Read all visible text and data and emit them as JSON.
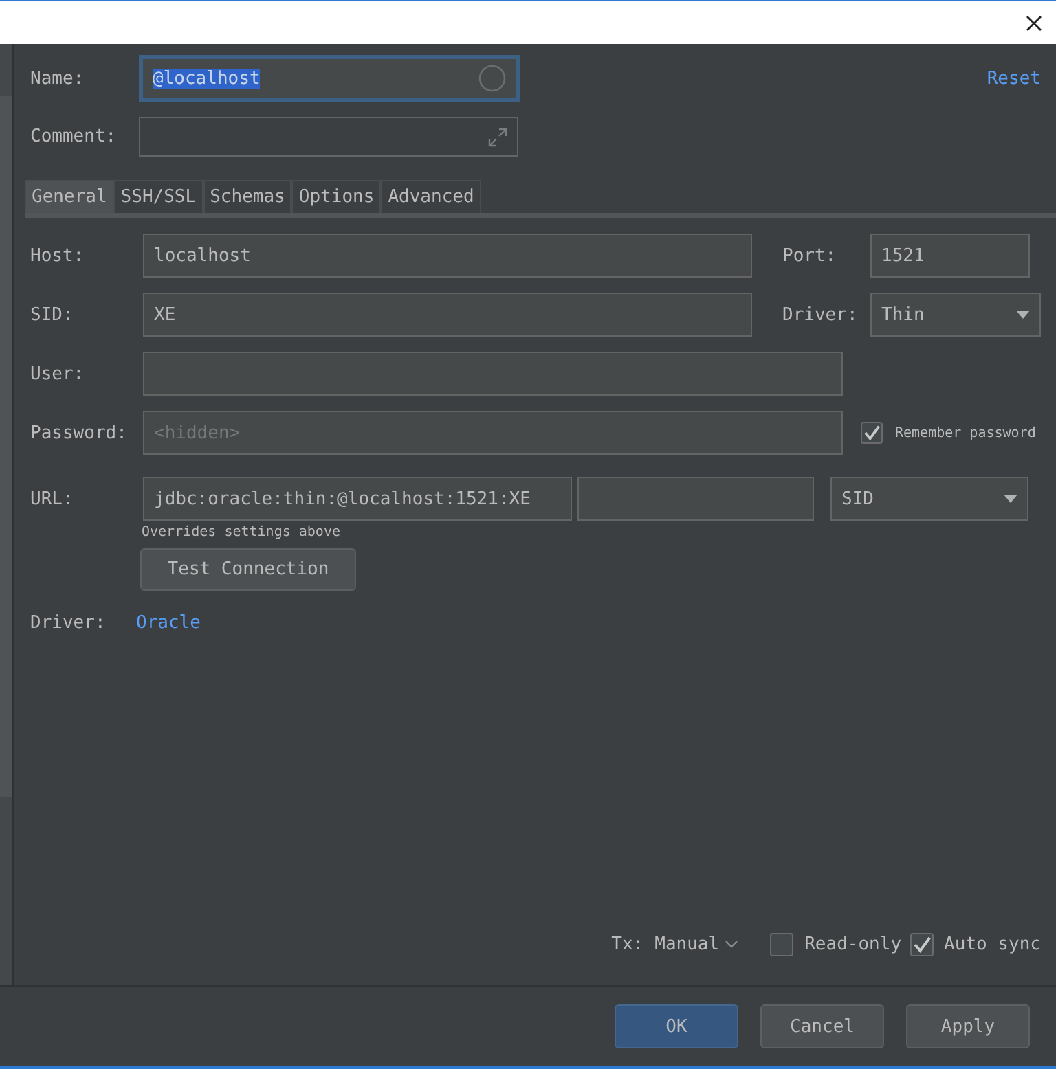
{
  "name": {
    "label": "Name:",
    "value": "@localhost",
    "focused": true
  },
  "reset_link": "Reset",
  "comment": {
    "label": "Comment:"
  },
  "tabs": [
    {
      "label": "General",
      "selected": true
    },
    {
      "label": "SSH/SSL",
      "selected": false
    },
    {
      "label": "Schemas",
      "selected": false
    },
    {
      "label": "Options",
      "selected": false
    },
    {
      "label": "Advanced",
      "selected": false
    }
  ],
  "host": {
    "label": "Host:",
    "value": "localhost"
  },
  "port": {
    "label": "Port:",
    "value": "1521"
  },
  "sid": {
    "label": "SID:",
    "value": "XE"
  },
  "driver_select": {
    "label": "Driver:",
    "value": "Thin"
  },
  "user": {
    "label": "User:"
  },
  "password": {
    "label": "Password:",
    "placeholder": "<hidden>"
  },
  "remember_password": {
    "label": "Remember password",
    "checked": true
  },
  "url": {
    "label": "URL:",
    "value": "jdbc:oracle:thin:@localhost:1521:XE",
    "type_value": "SID",
    "hint": "Overrides settings above"
  },
  "test_button": "Test Connection",
  "driver": {
    "label": "Driver:",
    "value": "Oracle"
  },
  "tx": {
    "label": "Tx:",
    "value": "Manual"
  },
  "read_only": {
    "label": "Read-only",
    "checked": false
  },
  "auto_sync": {
    "label": "Auto sync",
    "checked": true
  },
  "buttons": [
    {
      "label": "OK",
      "primary": true
    },
    {
      "label": "Cancel",
      "primary": false
    },
    {
      "label": "Apply",
      "primary": false
    }
  ]
}
